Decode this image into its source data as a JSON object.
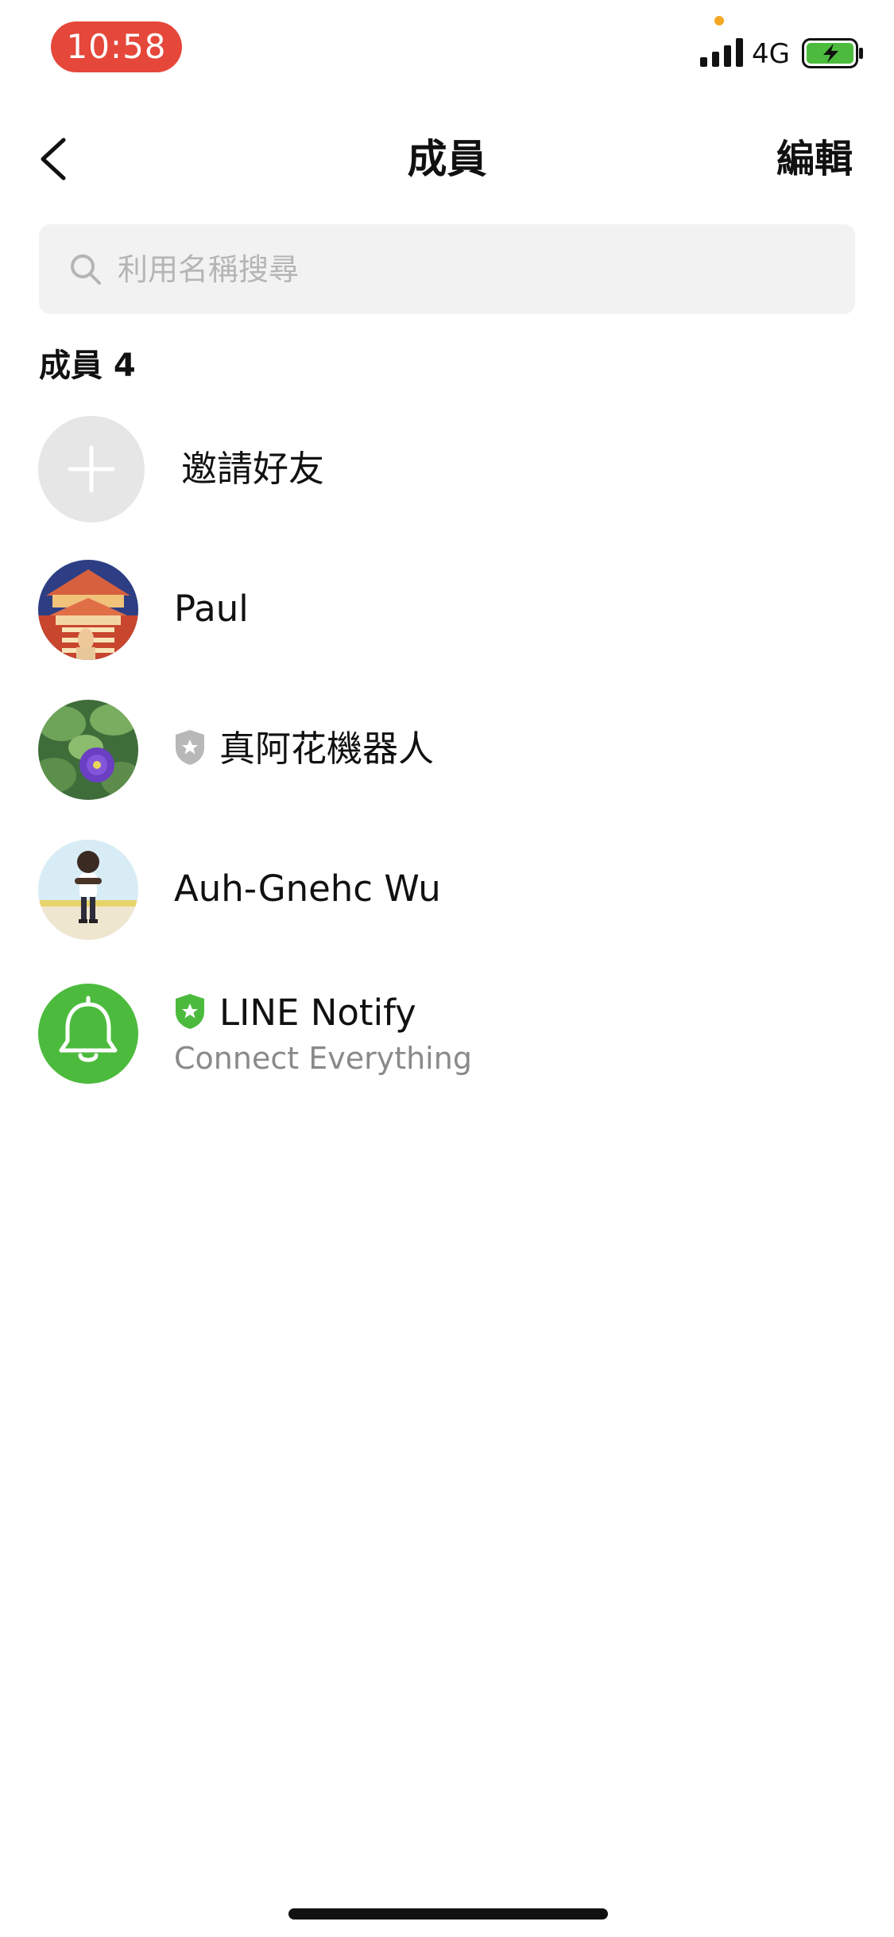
{
  "status_bar": {
    "time": "10:58",
    "network": "4G",
    "time_pill_color": "#e5473a",
    "battery_color": "#4cbb3d"
  },
  "nav": {
    "title": "成員",
    "edit_label": "編輯"
  },
  "search": {
    "placeholder": "利用名稱搜尋",
    "value": ""
  },
  "members": {
    "header": "成員 4",
    "invite_label": "邀請好友",
    "items": [
      {
        "name": "Paul",
        "avatar": "photo-temple"
      },
      {
        "name": "真阿花機器人",
        "avatar": "photo-purple-flower",
        "badge": "gray-shield-star-icon"
      },
      {
        "name": "Auh-Gnehc Wu",
        "avatar": "photo-cartoon-person"
      },
      {
        "name": "LINE Notify",
        "subtitle": "Connect Everything",
        "avatar": "bell-icon",
        "badge": "green-shield-star-icon"
      }
    ]
  },
  "colors": {
    "line_green": "#4cbb3d",
    "gray_shield": "#b8b8b8"
  }
}
